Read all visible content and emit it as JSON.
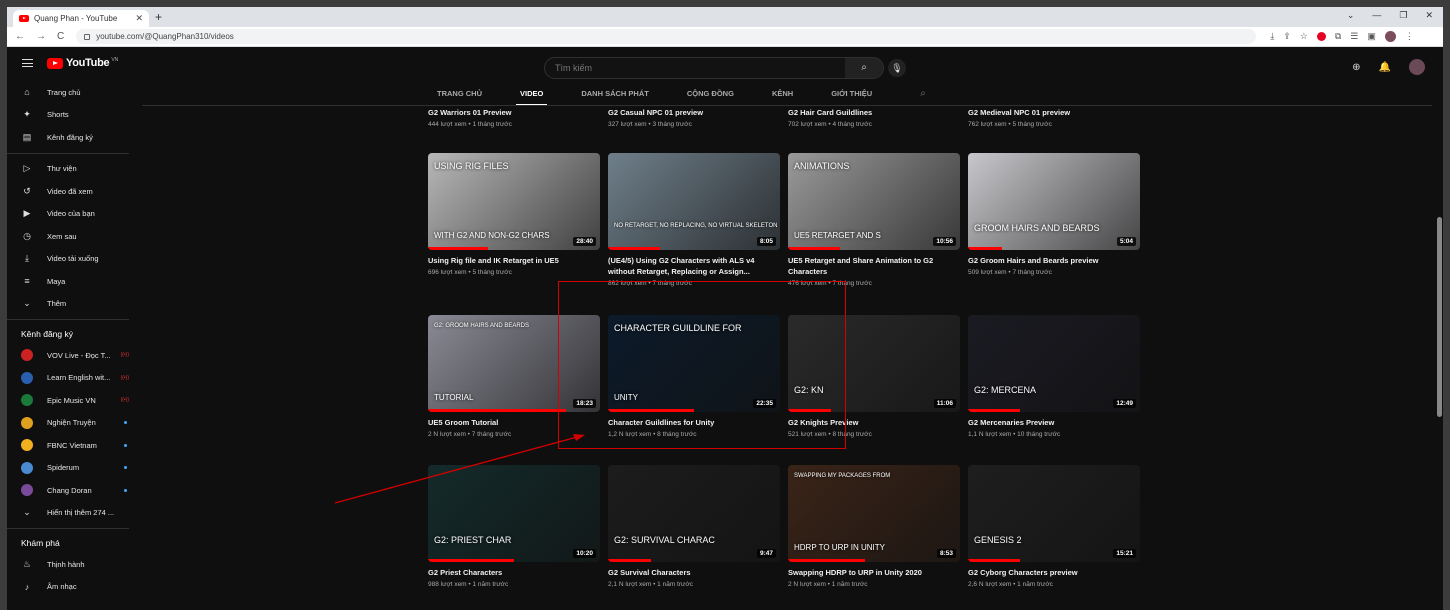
{
  "browser": {
    "tab_title": "Quang Phan - YouTube",
    "tab_close": "✕",
    "new_tab": "+",
    "window_controls": [
      "⌄",
      "—",
      "❐",
      "✕"
    ],
    "url": "youtube.com/@QuangPhan310/videos",
    "nav": [
      "←",
      "→",
      "C"
    ],
    "ext_icons": [
      "⤓",
      "⇪",
      "☆",
      "⧉",
      "☰",
      "▣",
      "⋮"
    ]
  },
  "youtube": {
    "logo_text": "YouTube",
    "logo_region": "VN",
    "search_placeholder": "Tìm kiếm",
    "search_icon": "⌕",
    "mic_icon": "🎙",
    "header_icons": [
      "⊕",
      "🔔"
    ]
  },
  "sidebar": {
    "main": [
      {
        "icon": "⌂",
        "label": "Trang chủ"
      },
      {
        "icon": "✦",
        "label": "Shorts"
      },
      {
        "icon": "▤",
        "label": "Kênh đăng ký"
      }
    ],
    "library": [
      {
        "icon": "▷",
        "label": "Thư viện"
      },
      {
        "icon": "↺",
        "label": "Video đã xem"
      },
      {
        "icon": "▶",
        "label": "Video của bạn"
      },
      {
        "icon": "◷",
        "label": "Xem sau"
      },
      {
        "icon": "⤓",
        "label": "Video tải xuống"
      },
      {
        "icon": "≡",
        "label": "Maya"
      },
      {
        "icon": "⌄",
        "label": "Thêm"
      }
    ],
    "subs_heading": "Kênh đăng ký",
    "subs": [
      {
        "label": "VOV Live - Đọc T...",
        "color": "#c22",
        "badge": "live"
      },
      {
        "label": "Learn English wit...",
        "color": "#2a5fb0",
        "badge": "live"
      },
      {
        "label": "Epic Music VN",
        "color": "#1a7a3a",
        "badge": "live"
      },
      {
        "label": "Nghiện Truyện",
        "color": "#e0a020",
        "badge": "dot"
      },
      {
        "label": "FBNC Vietnam",
        "color": "#f0b020",
        "badge": "dot"
      },
      {
        "label": "Spiderum",
        "color": "#4a8ad0",
        "badge": "dot"
      },
      {
        "label": "Chang Doran",
        "color": "#7a4a9a",
        "badge": "dot"
      }
    ],
    "show_more": "Hiển thị thêm 274 ...",
    "explore_heading": "Khám phá",
    "explore": [
      {
        "icon": "♨",
        "label": "Thịnh hành"
      },
      {
        "icon": "♪",
        "label": "Âm nhạc"
      }
    ]
  },
  "channel_tabs": [
    "TRANG CHỦ",
    "VIDEO",
    "DANH SÁCH PHÁT",
    "CỘNG ĐỒNG",
    "KÊNH",
    "GIỚI THIỆU"
  ],
  "active_tab": "VIDEO",
  "tab_search_icon": "⌕",
  "top_row": [
    {
      "title": "G2 Warriors 01 Preview",
      "meta": "444 lượt xem • 1 tháng trước"
    },
    {
      "title": "G2 Casual NPC 01 preview",
      "meta": "327 lượt xem • 3 tháng trước"
    },
    {
      "title": "G2 Hair Card Guildlines",
      "meta": "702 lượt xem • 4 tháng trước"
    },
    {
      "title": "G2 Medieval NPC 01 preview",
      "meta": "762 lượt xem • 5 tháng trước"
    }
  ],
  "rows": [
    [
      {
        "title": "Using Rig file and IK Retarget in UE5",
        "meta": "696 lượt xem • 5 tháng trước",
        "duration": "28:40",
        "overlay": "USING RIG FILES",
        "overlay2": "WITH G2 AND NON-G2 CHARS",
        "bg": "#b8b8b8",
        "progress": 0.35
      },
      {
        "title": "(UE4/5) Using G2 Characters with ALS v4 without Retarget, Replacing or Assign...",
        "meta": "862 lượt xem • 7 tháng trước",
        "duration": "8:05",
        "overlay": "NO RETARGET, NO REPLACING, NO VIRTUAL SKELETON",
        "overlay2": "",
        "bg": "#6f7f8a",
        "progress": 0.3
      },
      {
        "title": "UE5 Retarget and Share Animation to G2 Characters",
        "meta": "476 lượt xem • 7 tháng trước",
        "duration": "10:56",
        "overlay": "ANIMATIONS",
        "overlay2": "UE5 RETARGET AND S",
        "bg": "#9a9a9a",
        "progress": 0.3
      },
      {
        "title": "G2 Groom Hairs and Beards preview",
        "meta": "509 lượt xem • 7 tháng trước",
        "duration": "5:04",
        "overlay": "GROOM HAIRS AND BEARDS",
        "overlay2": "",
        "bg": "#c8c8cc",
        "progress": 0.2
      }
    ],
    [
      {
        "title": "UE5 Groom Tutorial",
        "meta": "2 N lượt xem • 7 tháng trước",
        "duration": "18:23",
        "overlay": "G2: GROOM HAIRS AND BEARDS",
        "overlay2": "TUTORIAL",
        "bg": "#8a8a95",
        "progress": 0.8
      },
      {
        "title": "Character Guildlines for Unity",
        "meta": "1,2 N lượt xem • 8 tháng trước",
        "duration": "22:35",
        "overlay": "CHARACTER GUILDLINE FOR",
        "overlay2": "UNITY",
        "bg": "#0c1a2a",
        "progress": 0.5
      },
      {
        "title": "G2 Knights Preview",
        "meta": "521 lượt xem • 8 tháng trước",
        "duration": "11:06",
        "overlay": "G2: KN",
        "overlay2": "",
        "bg": "#2a2a2a",
        "progress": 0.25
      },
      {
        "title": "G2 Mercenaries Preview",
        "meta": "1,1 N lượt xem • 10 tháng trước",
        "duration": "12:49",
        "overlay": "G2: MERCENA",
        "overlay2": "",
        "bg": "#1a1a22",
        "progress": 0.3
      }
    ],
    [
      {
        "title": "G2 Priest Characters",
        "meta": "988 lượt xem • 1 năm trước",
        "duration": "10:20",
        "overlay": "G2: PRIEST CHAR",
        "overlay2": "",
        "bg": "#142a2a",
        "progress": 0.5
      },
      {
        "title": "G2 Survival Characters",
        "meta": "2,1 N lượt xem • 1 năm trước",
        "duration": "9:47",
        "overlay": "G2: SURVIVAL CHARAC",
        "overlay2": "",
        "bg": "#1c1c1c",
        "progress": 0.25
      },
      {
        "title": "Swapping HDRP to URP in Unity 2020",
        "meta": "2 N lượt xem • 1 năm trước",
        "duration": "8:53",
        "overlay": "SWAPPING MY PACKAGES FROM",
        "overlay2": "HDRP TO URP IN UNITY",
        "bg": "#3a2418",
        "progress": 0.45
      },
      {
        "title": "G2 Cyborg Characters preview",
        "meta": "2,6 N lượt xem • 1 năm trước",
        "duration": "15:21",
        "overlay": "GENESIS 2",
        "overlay2": "",
        "bg": "#1e1e1e",
        "progress": 0.3
      }
    ]
  ],
  "annotation_color": "#d40000"
}
